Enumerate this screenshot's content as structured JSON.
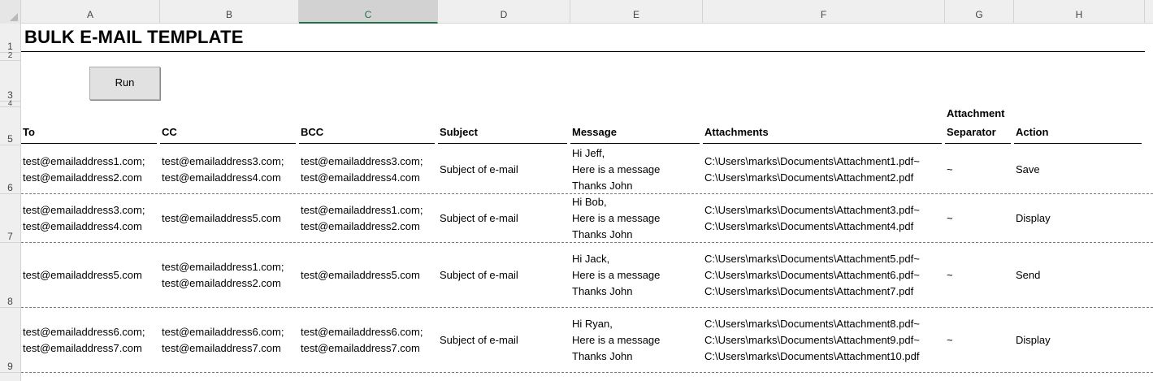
{
  "columns": [
    {
      "letter": "A"
    },
    {
      "letter": "B"
    },
    {
      "letter": "C"
    },
    {
      "letter": "D"
    },
    {
      "letter": "E"
    },
    {
      "letter": "F"
    },
    {
      "letter": "G"
    },
    {
      "letter": "H"
    }
  ],
  "selected_column": "C",
  "rows": [
    "1",
    "2",
    "3",
    "4",
    "5",
    "6",
    "7",
    "8",
    "9"
  ],
  "title": "BULK E-MAIL TEMPLATE",
  "run_button": "Run",
  "headers": {
    "to": "To",
    "cc": "CC",
    "bcc": "BCC",
    "subject": "Subject",
    "message": "Message",
    "attachments": "Attachments",
    "separator_line1": "Attachment",
    "separator_line2": "Separator",
    "action": "Action"
  },
  "records": [
    {
      "to": [
        "test@emailaddress1.com;",
        "test@emailaddress2.com"
      ],
      "cc": [
        "test@emailaddress3.com;",
        "test@emailaddress4.com"
      ],
      "bcc": [
        "test@emailaddress3.com;",
        "test@emailaddress4.com"
      ],
      "subject": [
        "Subject of e-mail"
      ],
      "message": [
        "Hi Jeff,",
        "Here is a message",
        "Thanks John"
      ],
      "attachments": [
        "C:\\Users\\marks\\Documents\\Attachment1.pdf~",
        "C:\\Users\\marks\\Documents\\Attachment2.pdf"
      ],
      "separator": [
        "~"
      ],
      "action": [
        "Save"
      ]
    },
    {
      "to": [
        "test@emailaddress3.com;",
        "test@emailaddress4.com"
      ],
      "cc": [
        "test@emailaddress5.com"
      ],
      "bcc": [
        "test@emailaddress1.com;",
        "test@emailaddress2.com"
      ],
      "subject": [
        "Subject of e-mail"
      ],
      "message": [
        "Hi Bob,",
        "Here is a message",
        "Thanks John"
      ],
      "attachments": [
        "C:\\Users\\marks\\Documents\\Attachment3.pdf~",
        "C:\\Users\\marks\\Documents\\Attachment4.pdf"
      ],
      "separator": [
        "~"
      ],
      "action": [
        "Display"
      ]
    },
    {
      "to": [
        "test@emailaddress5.com"
      ],
      "cc": [
        "test@emailaddress1.com;",
        "test@emailaddress2.com"
      ],
      "bcc": [
        "test@emailaddress5.com"
      ],
      "subject": [
        "Subject of e-mail"
      ],
      "message": [
        "Hi Jack,",
        "Here is a message",
        "Thanks John"
      ],
      "attachments": [
        "C:\\Users\\marks\\Documents\\Attachment5.pdf~",
        "C:\\Users\\marks\\Documents\\Attachment6.pdf~",
        "C:\\Users\\marks\\Documents\\Attachment7.pdf"
      ],
      "separator": [
        "~"
      ],
      "action": [
        "Send"
      ]
    },
    {
      "to": [
        "test@emailaddress6.com;",
        "test@emailaddress7.com"
      ],
      "cc": [
        "test@emailaddress6.com;",
        "test@emailaddress7.com"
      ],
      "bcc": [
        "test@emailaddress6.com;",
        "test@emailaddress7.com"
      ],
      "subject": [
        "Subject of e-mail"
      ],
      "message": [
        "Hi Ryan,",
        "Here is a message",
        "Thanks John"
      ],
      "attachments": [
        "C:\\Users\\marks\\Documents\\Attachment8.pdf~",
        "C:\\Users\\marks\\Documents\\Attachment9.pdf~",
        "C:\\Users\\marks\\Documents\\Attachment10.pdf"
      ],
      "separator": [
        "~"
      ],
      "action": [
        "Display"
      ]
    }
  ],
  "colors": {
    "header_bg": "#efefef",
    "selected_accent": "#217346",
    "gridline": "#d4d4d4"
  }
}
